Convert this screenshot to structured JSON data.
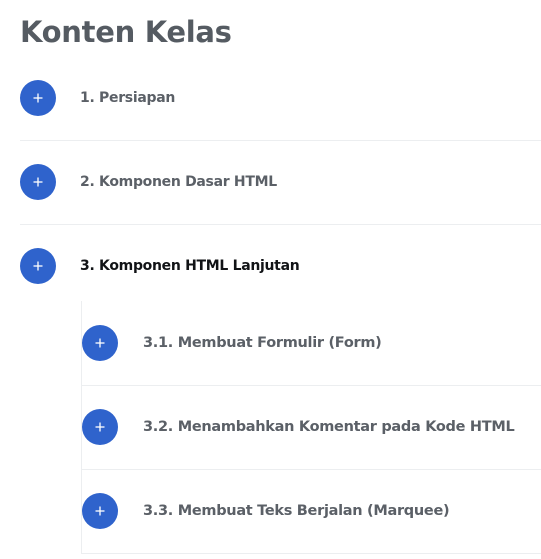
{
  "page": {
    "title": "Konten Kelas"
  },
  "colors": {
    "accent": "#2f63cc",
    "text_muted": "#5b6067",
    "text_active": "#111316",
    "divider": "#eceef0"
  },
  "sections": [
    {
      "label": "1. Persiapan",
      "icon": "plus-icon",
      "expanded": false
    },
    {
      "label": "2. Komponen Dasar HTML",
      "icon": "plus-icon",
      "expanded": false
    },
    {
      "label": "3. Komponen HTML Lanjutan",
      "icon": "plus-icon",
      "expanded": true,
      "children": [
        {
          "label": "3.1. Membuat Formulir (Form)",
          "icon": "plus-icon"
        },
        {
          "label": "3.2. Menambahkan Komentar pada Kode HTML",
          "icon": "plus-icon"
        },
        {
          "label": "3.3. Membuat Teks Berjalan (Marquee)",
          "icon": "plus-icon"
        }
      ]
    }
  ]
}
